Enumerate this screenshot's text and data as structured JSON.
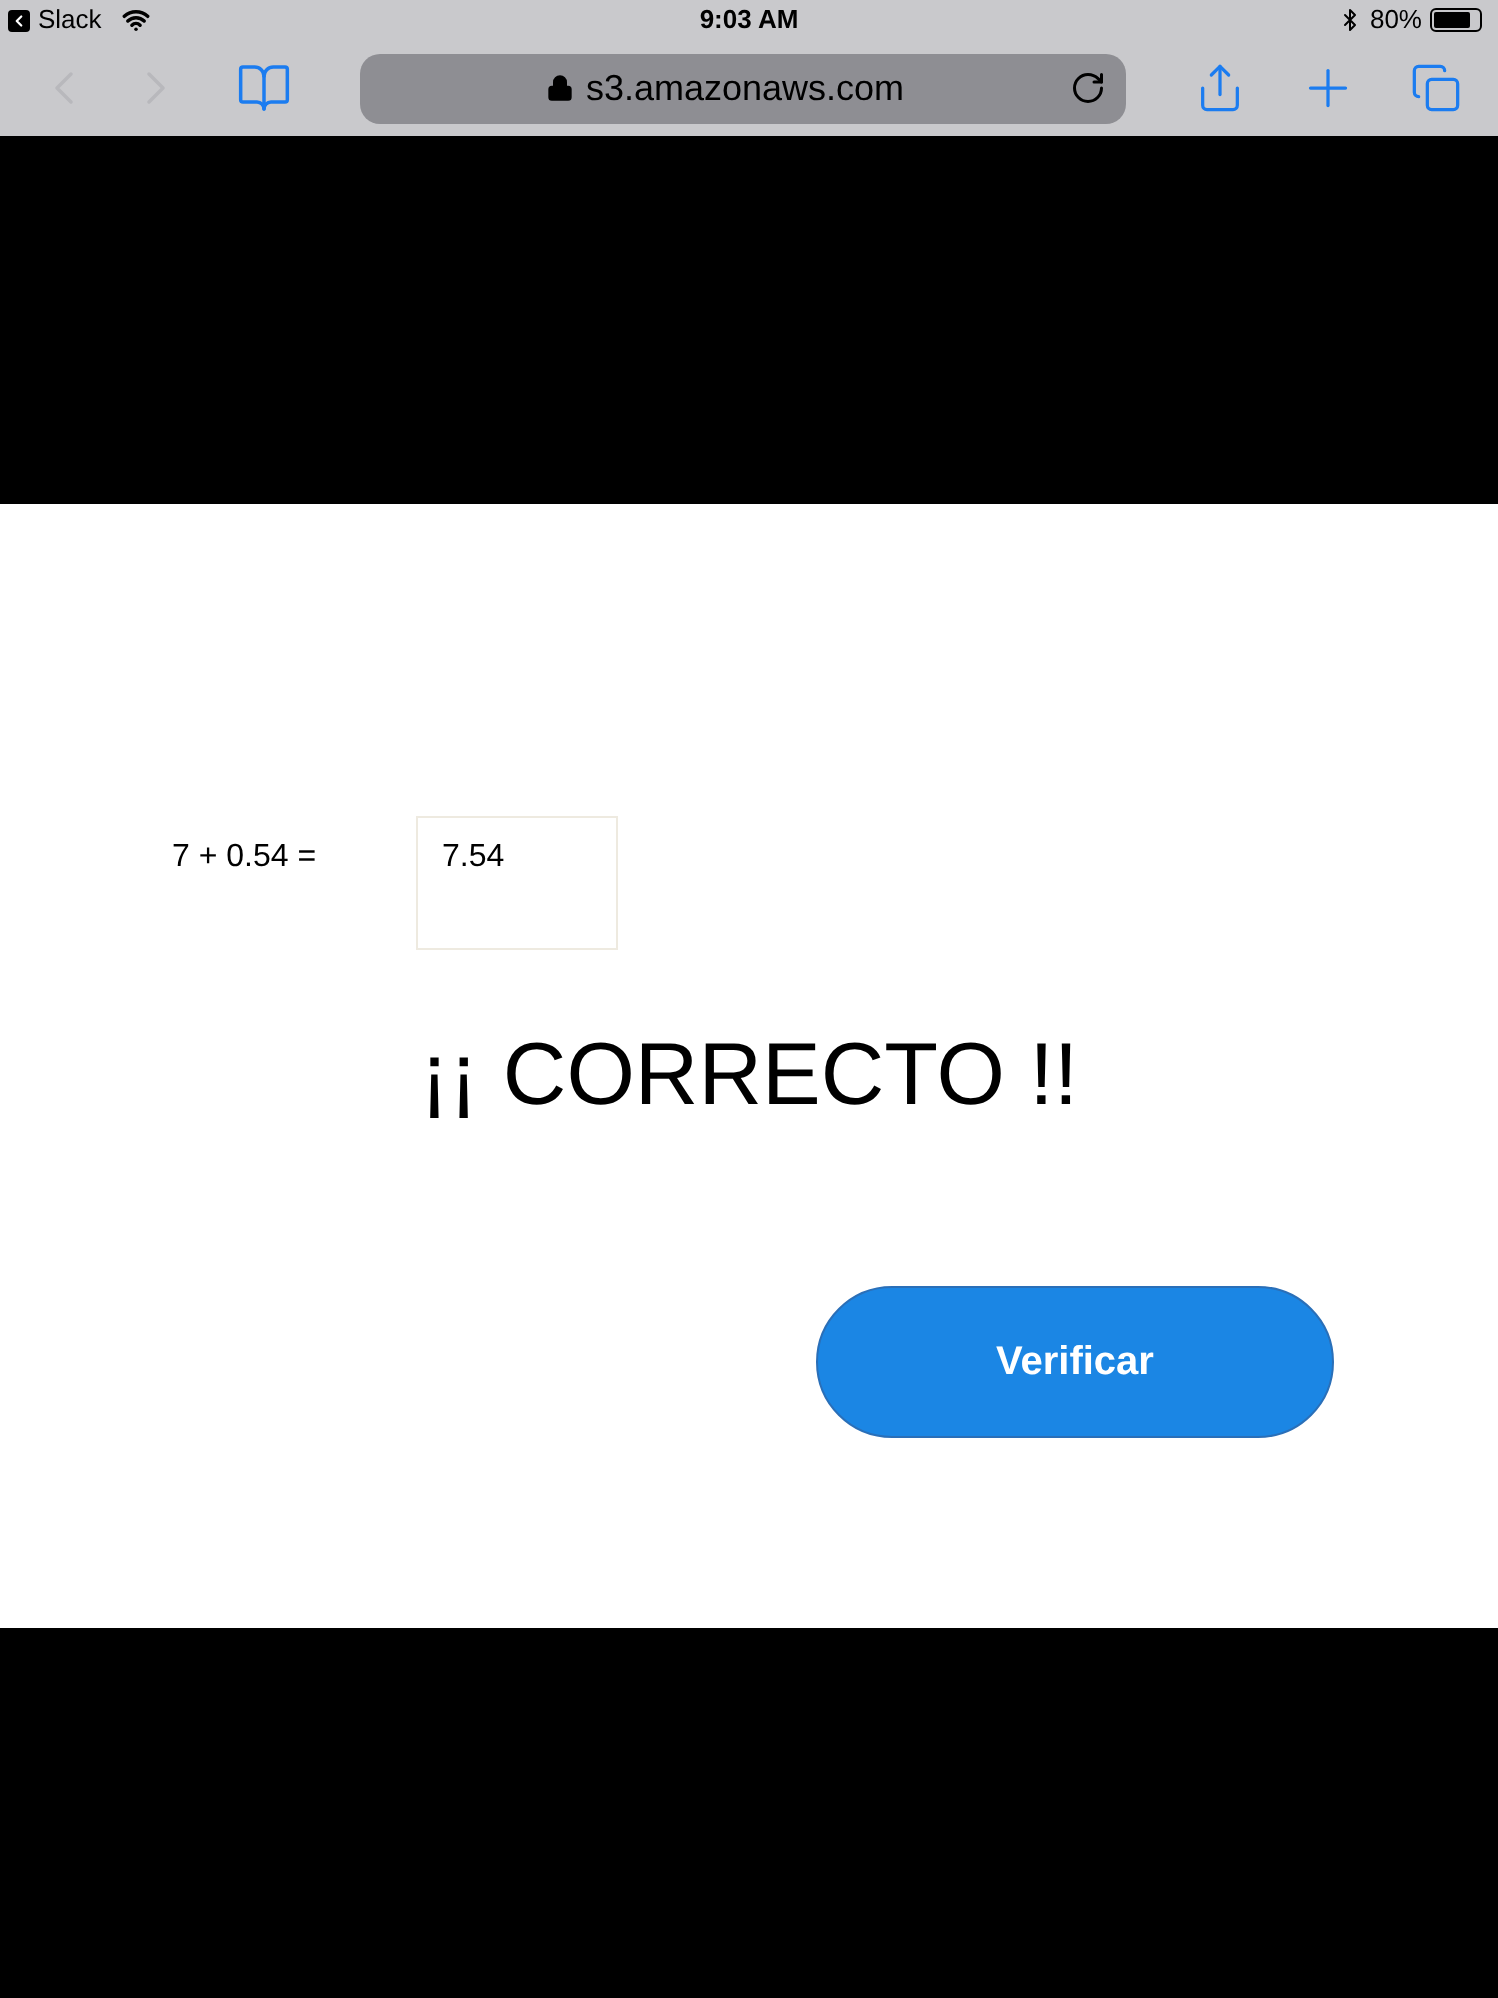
{
  "status_bar": {
    "back_app": "Slack",
    "time": "9:03 AM",
    "battery": "80%"
  },
  "browser": {
    "url": "s3.amazonaws.com",
    "back_disabled": true,
    "forward_disabled": true
  },
  "exercise": {
    "equation": "7 + 0.54 =",
    "answer": "7.54",
    "feedback": "¡¡ CORRECTO !!",
    "button": "Verificar"
  }
}
